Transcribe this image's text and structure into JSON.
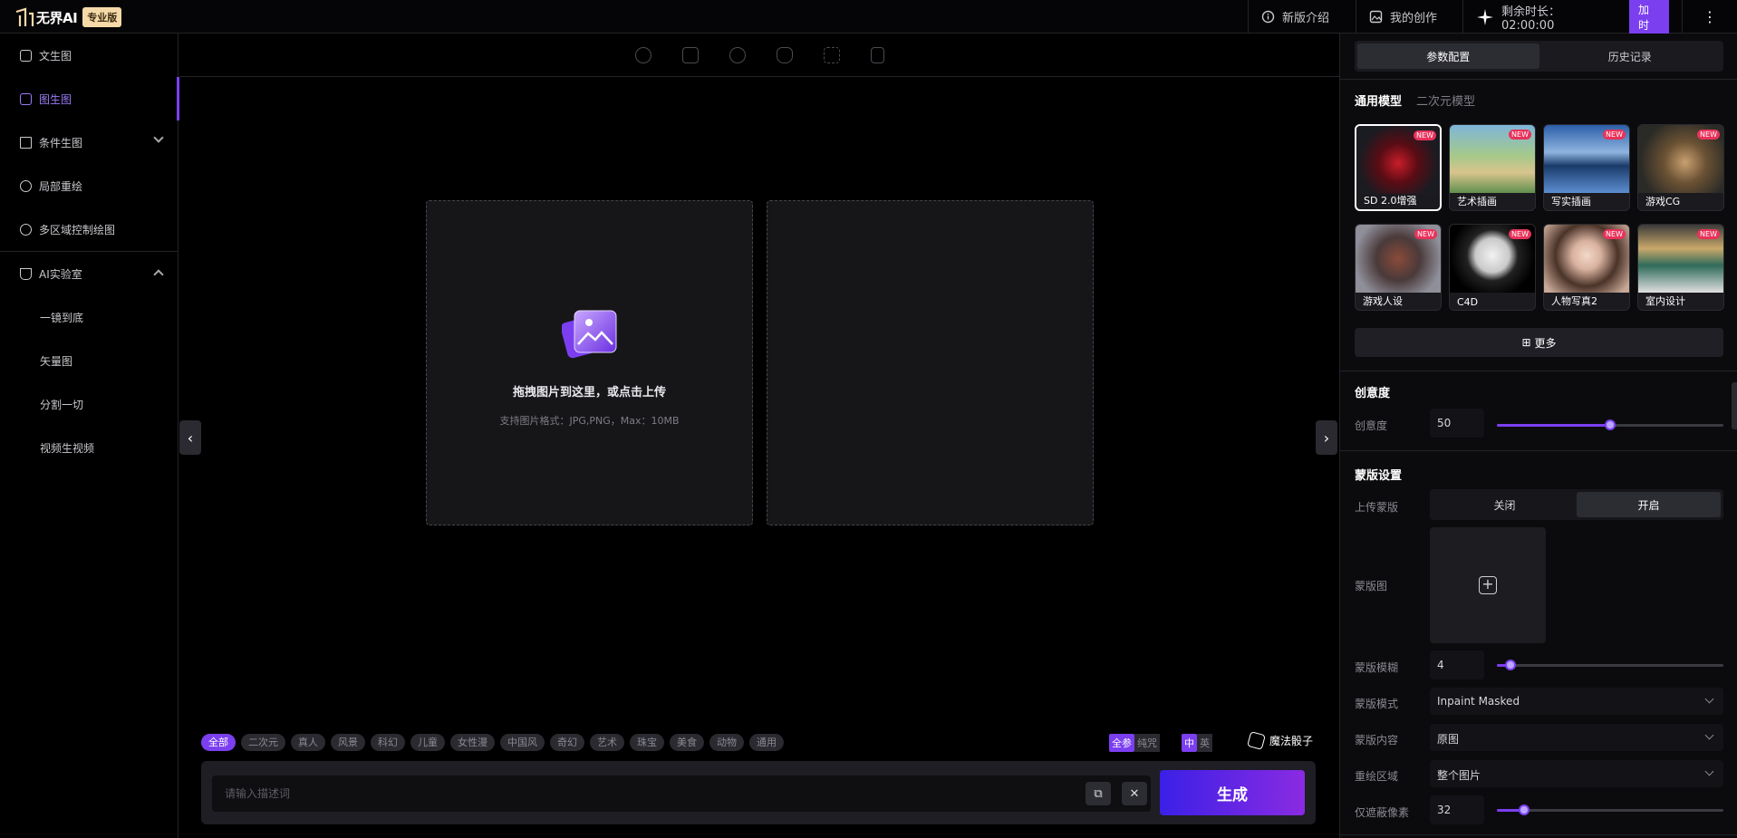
{
  "header": {
    "logo_text": "无界AI",
    "edition": "专业版",
    "nav_intro": "新版介绍",
    "nav_mine": "我的创作",
    "remaining_label": "剩余时长：02:00:00",
    "add_time": "加时",
    "more": "⋮"
  },
  "sidebar": {
    "items": [
      {
        "label": "文生图"
      },
      {
        "label": "图生图"
      },
      {
        "label": "条件生图"
      },
      {
        "label": "局部重绘"
      },
      {
        "label": "多区域控制绘图"
      },
      {
        "label": "AI实验室"
      },
      {
        "label": "一镜到底"
      },
      {
        "label": "矢量图"
      },
      {
        "label": "分割一切"
      },
      {
        "label": "视频生视频"
      }
    ],
    "active_index": 1
  },
  "canvas": {
    "upload_title": "拖拽图片到这里，或点击上传",
    "upload_hint": "支持图片格式：JPG,PNG，Max：10MB",
    "left_arrow": "‹",
    "right_arrow": "›"
  },
  "prompt": {
    "tags": [
      "全部",
      "二次元",
      "真人",
      "风景",
      "科幻",
      "儿童",
      "女性漫",
      "中国风",
      "奇幻",
      "艺术",
      "珠宝",
      "美食",
      "动物",
      "通用"
    ],
    "active_tag": 0,
    "lang_a_on": "全参",
    "lang_a_off": "纯咒",
    "lang_b_on": "中",
    "lang_b_off": "英",
    "dice_label": "魔法骰子",
    "placeholder": "请输入描述词",
    "copy_icon": "⧉",
    "clear_icon": "✕",
    "generate": "生成"
  },
  "panel": {
    "tab_config": "参数配置",
    "tab_history": "历史记录",
    "model_tab_general": "通用模型",
    "model_tab_anime": "二次元模型",
    "models": [
      {
        "name": "SD 2.0增强",
        "badge": "NEW"
      },
      {
        "name": "艺术插画",
        "badge": "NEW"
      },
      {
        "name": "写实插画",
        "badge": "NEW"
      },
      {
        "name": "游戏CG",
        "badge": "NEW"
      },
      {
        "name": "游戏人设",
        "badge": "NEW"
      },
      {
        "name": "C4D",
        "badge": "NEW"
      },
      {
        "name": "人物写真2",
        "badge": "NEW"
      },
      {
        "name": "室内设计",
        "badge": "NEW"
      }
    ],
    "selected_model": 0,
    "more": "更多",
    "more_icon": "⊞",
    "creativity_title": "创意度",
    "creativity_label": "创意度",
    "creativity_value": "50",
    "creativity_fraction": 0.5,
    "mask_title": "蒙版设置",
    "upload_mask": "上传蒙版",
    "toggle_off": "关闭",
    "toggle_on": "开启",
    "mask_image": "蒙版图",
    "mask_blur_label": "蒙版模糊",
    "mask_blur_value": "4",
    "mask_blur_fraction": 0.06,
    "mask_mode_label": "蒙版模式",
    "mask_mode_value": "Inpaint Masked",
    "mask_content_label": "蒙版内容",
    "mask_content_value": "原图",
    "repaint_area_label": "重绘区域",
    "repaint_area_value": "整个图片",
    "mask_pixels_label": "仅遮蔽像素",
    "mask_pixels_value": "32",
    "mask_pixels_fraction": 0.12
  },
  "colors": {
    "accent": "#7b3ff0",
    "badge": "#e8325a",
    "pro": "#f5d9a8"
  }
}
